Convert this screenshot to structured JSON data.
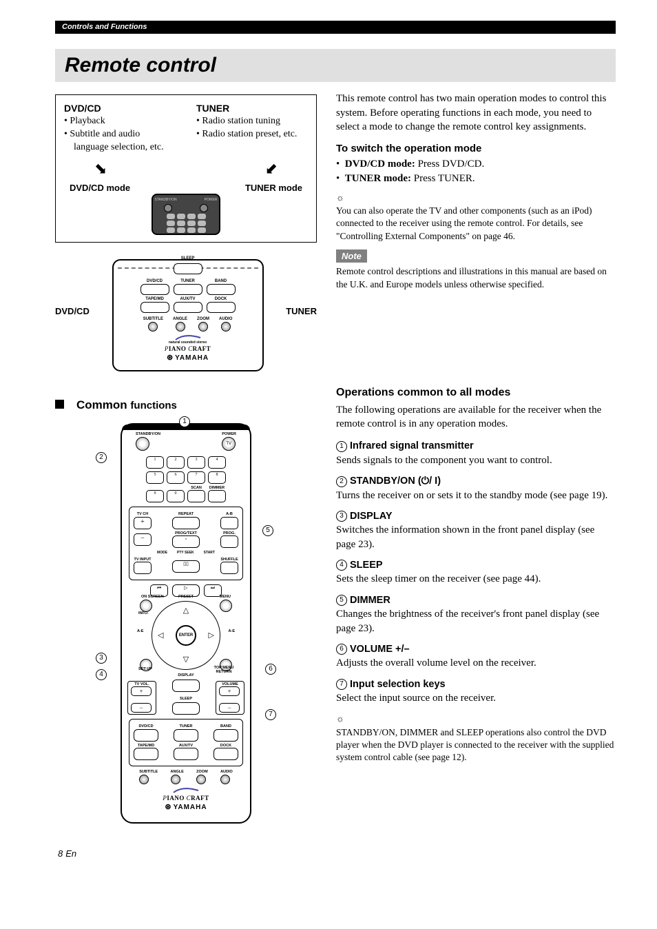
{
  "header_bar": "Controls and Functions",
  "title": "Remote control",
  "mode_box": {
    "dvd_head": "DVD/CD",
    "dvd_bullets": [
      "• Playback",
      "• Subtitle and audio language selection, etc."
    ],
    "tuner_head": "TUNER",
    "tuner_bullets": [
      "• Radio station tuning",
      "• Radio station preset, etc."
    ],
    "dvd_mode_label": "DVD/CD mode",
    "tuner_mode_label": "TUNER mode"
  },
  "zoom": {
    "left_label": "DVD/CD",
    "right_label": "TUNER",
    "row1_labels": [
      "DVD/CD",
      "TUNER",
      "BAND"
    ],
    "row2_labels": [
      "TAPE/MD",
      "AUX/TV",
      "DOCK"
    ],
    "row3_labels": [
      "SUBTITLE",
      "ANGLE",
      "ZOOM",
      "AUDIO"
    ],
    "brand1": "PIANO CRAFT",
    "brand2": "YAMAHA",
    "tagline1": "natural sounded stereo"
  },
  "intro_para": "This remote control has two main operation modes to control this system. Before operating functions in each mode, you need to select a mode to change the remote control key assignments.",
  "switch_head": "To switch the operation mode",
  "switch_dvd_bold": "DVD/CD mode:",
  "switch_dvd_rest": " Press DVD/CD.",
  "switch_tuner_bold": "TUNER mode:",
  "switch_tuner_rest": " Press TUNER.",
  "tip_text": "You can also operate the TV and other components (such as an iPod) connected to the receiver using the remote control. For details, see \"Controlling External Components\" on page 46.",
  "note_label": "Note",
  "note_text": "Remote control descriptions and illustrations in this manual are based on the U.K. and Europe models unless otherwise specified.",
  "common_head_main": "Common",
  "common_head_sub": "functions",
  "remote_labels": {
    "standby": "STANDBY/ON",
    "power": "POWER",
    "tv": "TV",
    "scan": "SCAN",
    "dimmer": "DIMMER",
    "tvch": "TV CH",
    "repeat": "REPEAT",
    "ab": "A-B",
    "prog": "PROG.",
    "progtext": "PROG/TEXT",
    "mode": "MODE",
    "pty": "PTY SEEK",
    "start": "START",
    "tvinput": "TV INPUT",
    "shuffle": "SHUFFLE",
    "onscreen": "ON SCREEN",
    "preset": "PRESET",
    "menu": "MENU",
    "info": "INFO.",
    "ae1": "A-E",
    "ae2": "A-E",
    "enter": "ENTER",
    "setup": "SET UP",
    "topmenu": "TOP MENU RETURN",
    "tvvol": "TV VOL.",
    "display": "DISPLAY",
    "volume": "VOLUME",
    "sleep": "SLEEP",
    "dvdcd": "DVD/CD",
    "tuner": "TUNER",
    "band": "BAND",
    "tapemd": "TAPE/MD",
    "auxtv": "AUX/TV",
    "dock": "DOCK",
    "subtitle": "SUBTITLE",
    "angle": "ANGLE",
    "zoom": "ZOOM",
    "audio": "AUDIO"
  },
  "ops_head": "Operations common to all modes",
  "ops_intro": "The following operations are available for the receiver when the remote control is in any operation modes.",
  "ops": [
    {
      "num": "1",
      "head": "Infrared signal transmitter",
      "body": "Sends signals to the component you want to control."
    },
    {
      "num": "2",
      "head": "STANDBY/ON (⏻/ I)",
      "body": "Turns the receiver on or sets it to the standby mode (see page 19)."
    },
    {
      "num": "3",
      "head": "DISPLAY",
      "body": "Switches the information shown in the front panel display (see page 23)."
    },
    {
      "num": "4",
      "head": "SLEEP",
      "body": "Sets the sleep timer on the receiver (see page 44)."
    },
    {
      "num": "5",
      "head": "DIMMER",
      "body": "Changes the brightness of the receiver's front panel display (see page 23)."
    },
    {
      "num": "6",
      "head": "VOLUME +/–",
      "body": "Adjusts the overall volume level on the receiver."
    },
    {
      "num": "7",
      "head": "Input selection keys",
      "body": "Select the input source on the receiver."
    }
  ],
  "final_tip": "STANDBY/ON, DIMMER and SLEEP operations also control the DVD player when the DVD player is connected to the receiver with the supplied system control cable (see page 12).",
  "page_num": "8",
  "page_lang": "En"
}
